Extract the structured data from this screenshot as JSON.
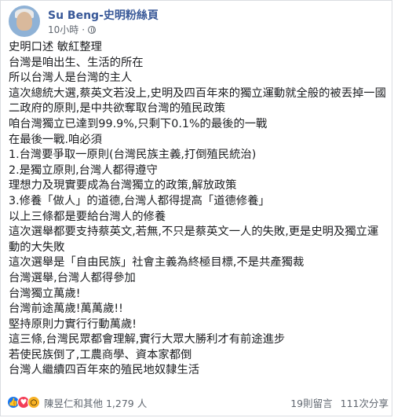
{
  "post": {
    "author": "Su Beng-史明粉絲頁",
    "time": "10小時",
    "lines": [
      "史明口述 敏紅整理",
      "台灣是咱出生、生活的所在",
      "所以台灣人是台灣的主人",
      "這次總統大選,蔡英文若没上,史明及四百年來的獨立運動就全般的被丟掉一國二政府的原則,是中共欲奪取台灣的殖民政策",
      "咱台灣獨立已達到99.9%,只剩下0.1%的最後的一戰",
      "在最後一戰.咱必須",
      "1.台灣要爭取一原則(台灣民族主義,打倒殖民統治)",
      "2.是獨立原則,台灣人都得遵守",
      "理想力及現實要成為台灣獨立的政策,解放政策",
      "3.修養「做人」的道德,台灣人都得提高「道德修養」",
      "以上三條都是要給台灣人的修養",
      "這次選舉都要支持蔡英文,若無,不只是蔡英文一人的失敗,更是史明及獨立運動的大失敗",
      "這次選舉是「自由民族」社會主義為終極目標,不是共產獨裁",
      "台灣選舉,台灣人都得參加",
      "台灣獨立萬歲!",
      "台灣前途萬歲!萬萬歲!!",
      "堅持原則力實行行動萬歲!",
      "這三條,台灣民眾都會理解,實行大眾大勝利才有前途進步",
      "若使民族倒了,工農商學、資本家都倒",
      "台灣人繼續四百年來的殖民地奴隸生活"
    ]
  },
  "footer": {
    "reactions_text": "陳昱仁和其他 1,279 人",
    "comments": "19則留言",
    "shares": "111次分享",
    "icons": [
      "like-icon",
      "love-icon",
      "wow-icon"
    ]
  },
  "colors": {
    "name": "#385898",
    "text": "#1c1e21",
    "meta": "#606770"
  }
}
